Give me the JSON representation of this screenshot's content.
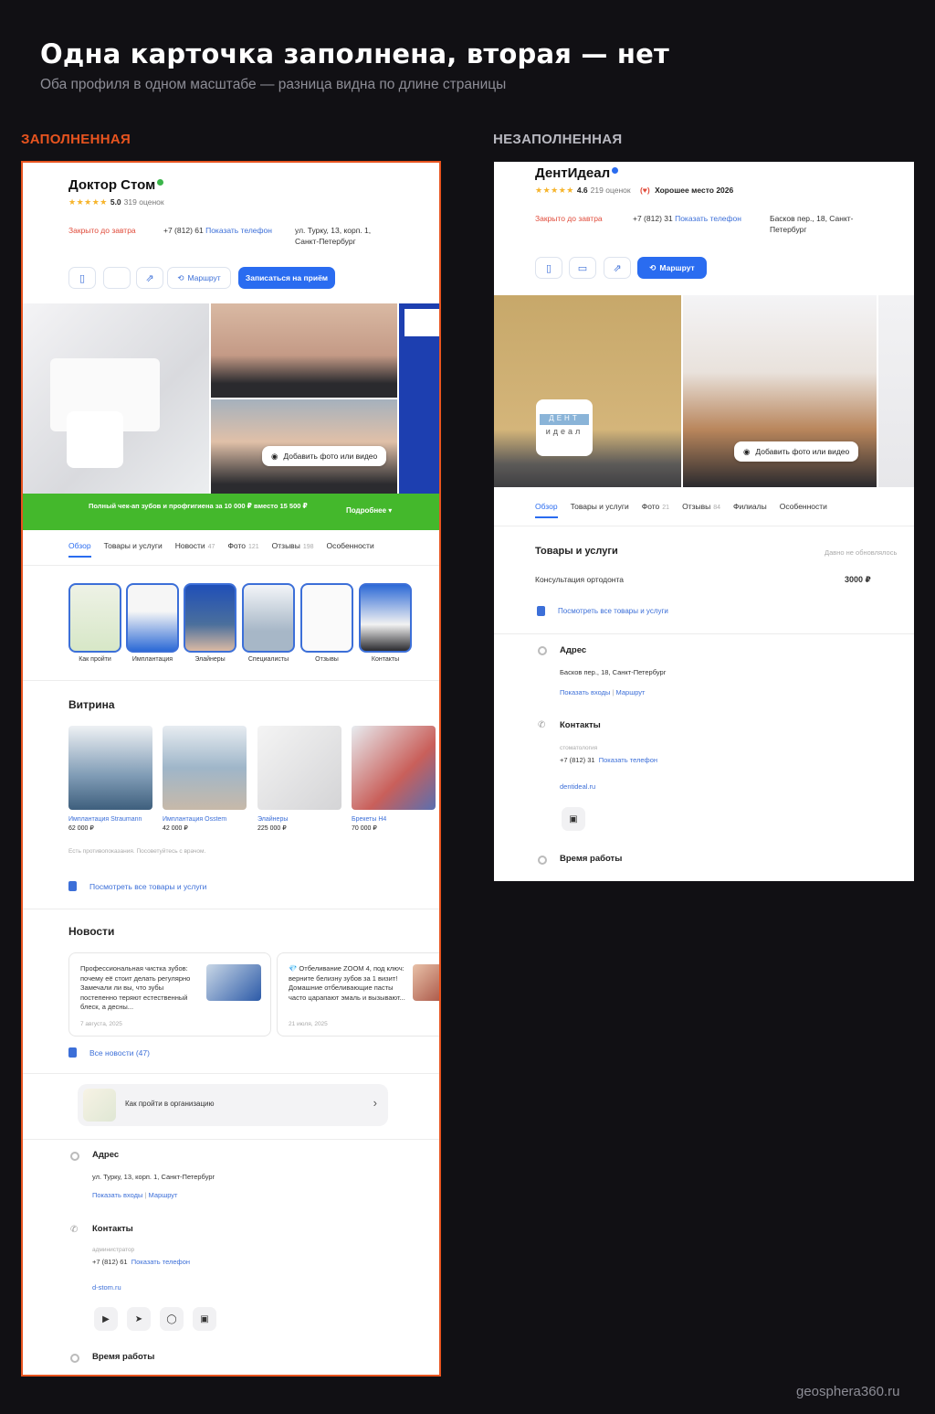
{
  "header": {
    "title": "Одна карточка заполнена, вторая — нет",
    "subtitle": "Оба профиля в одном масштабе — разница видна по длине страницы"
  },
  "labels": {
    "left": "ЗАПОЛНЕННАЯ",
    "right": "НЕЗАПОЛНЕННАЯ"
  },
  "colors": {
    "accent_orange": "#e8541f",
    "primary_blue": "#2a6cf0",
    "promo_green": "#44b82c"
  },
  "left": {
    "name": "Доктор Стом",
    "rating_stars": "★★★★★",
    "rating": "5.0",
    "reviews": "319 оценок",
    "status": "Закрыто до завтра",
    "phone": "+7 (812) 61",
    "show_phone": "Показать телефон",
    "address_line1": "ул. Турку, 13, корп. 1,",
    "address_line2": "Санкт-Петербург",
    "route": "Маршрут",
    "book": "Записаться на приём",
    "add_photo": "Добавить фото или видео",
    "promo": "Полный чек-ап зубов и профгигиена за 10 000 ₽ вместо 15 500 ₽",
    "promo_more": "Подробнее",
    "tabs": [
      {
        "label": "Обзор",
        "count": ""
      },
      {
        "label": "Товары и услуги",
        "count": ""
      },
      {
        "label": "Новости",
        "count": "47"
      },
      {
        "label": "Фото",
        "count": "121"
      },
      {
        "label": "Отзывы",
        "count": "198"
      },
      {
        "label": "Особенности",
        "count": ""
      }
    ],
    "stories": [
      "Как пройти",
      "Имплантация",
      "Элайнеры",
      "Специалисты",
      "Отзывы",
      "Контакты"
    ],
    "vitrina_title": "Витрина",
    "vitrina": [
      {
        "name": "Имплантация Straumann",
        "price": "62 000 ₽"
      },
      {
        "name": "Имплантация Osstem",
        "price": "42 000 ₽"
      },
      {
        "name": "Элайнеры",
        "price": "225 000 ₽"
      },
      {
        "name": "Брекеты H4",
        "price": "70 000 ₽"
      }
    ],
    "vitrina_note": "Есть противопоказания. Посоветуйтесь с врачом.",
    "all_goods": "Посмотреть все товары и услуги",
    "news_title": "Новости",
    "news": [
      {
        "text": "Профессиональная чистка зубов: почему её стоит делать регулярно Замечали ли вы, что зубы постепенно теряют естественный блеск, а десны...",
        "date": "7 августа, 2025"
      },
      {
        "text": "💎 Отбеливание ZOOM 4, под ключ: верните белизну зубов за 1 визит! Домашние отбеливающие пасты часто царапают эмаль и вызывают...",
        "date": "21 июля, 2025"
      }
    ],
    "all_news": "Все новости (47)",
    "howto": "Как пройти в организацию",
    "address_title": "Адрес",
    "address_full": "ул. Турку, 13, корп. 1, Санкт-Петербург",
    "show_entrances": "Показать входы",
    "route_link": "Маршрут",
    "contacts_title": "Контакты",
    "contacts_caption": "администратор",
    "contacts_phone": "+7 (812) 61",
    "site": "d-stom.ru",
    "hours_title": "Время работы"
  },
  "right": {
    "name": "ДентИдеал",
    "rating_stars": "★★★★★",
    "rating": "4.6",
    "reviews": "219 оценок",
    "award": "Хорошее место 2026",
    "status": "Закрыто до завтра",
    "phone": "+7 (812) 31",
    "show_phone": "Показать телефон",
    "address_line1": "Басков пер., 18, Санкт-",
    "address_line2": "Петербург",
    "route": "Маршрут",
    "add_photo": "Добавить фото или видео",
    "logo_text1": "ДЕНТ",
    "logo_text2": "идеал",
    "tabs": [
      {
        "label": "Обзор",
        "count": ""
      },
      {
        "label": "Товары и услуги",
        "count": ""
      },
      {
        "label": "Фото",
        "count": "21"
      },
      {
        "label": "Отзывы",
        "count": "84"
      },
      {
        "label": "Филиалы",
        "count": ""
      },
      {
        "label": "Особенности",
        "count": ""
      }
    ],
    "goods_title": "Товары и услуги",
    "goods_note": "Давно не обновлялось",
    "goods_item": "Консультация ортодонта",
    "goods_price": "3000 ₽",
    "all_goods": "Посмотреть все товары и услуги",
    "address_title": "Адрес",
    "address_full": "Басков пер., 18, Санкт-Петербург",
    "show_entrances": "Показать входы",
    "route_link": "Маршрут",
    "contacts_title": "Контакты",
    "contacts_caption": "стоматология",
    "contacts_phone": "+7 (812) 31",
    "site": "dentideal.ru",
    "hours_title": "Время работы"
  },
  "watermark": "geosphera360.ru"
}
